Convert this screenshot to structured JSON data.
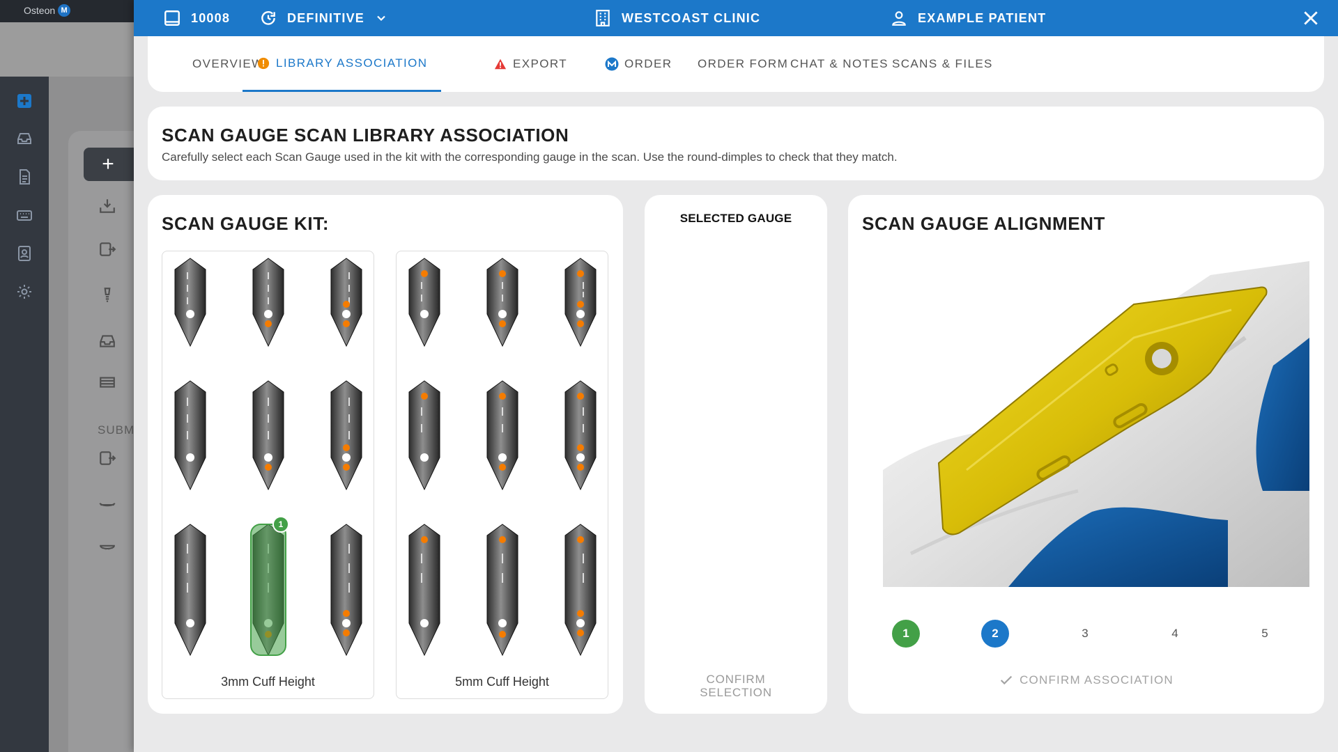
{
  "background": {
    "logo_text": "Osteon",
    "logo_mark": "M",
    "new_button": "+",
    "submenu_label": "SUBM"
  },
  "header": {
    "case_number": "10008",
    "stage": "DEFINITIVE",
    "clinic": "WESTCOAST CLINIC",
    "patient": "EXAMPLE PATIENT"
  },
  "tabs": [
    {
      "label": "OVERVIEW"
    },
    {
      "label": "LIBRARY ASSOCIATION"
    },
    {
      "label": "EXPORT"
    },
    {
      "label": "ORDER"
    },
    {
      "label": "ORDER FORM"
    },
    {
      "label": "CHAT & NOTES"
    },
    {
      "label": "SCANS & FILES"
    }
  ],
  "main": {
    "title": "SCAN GAUGE SCAN LIBRARY ASSOCIATION",
    "description": "Carefully select each Scan Gauge used in the kit with the corresponding gauge in the scan. Use the round-dimples to check that they match."
  },
  "kit": {
    "title": "SCAN GAUGE KIT:",
    "groups": [
      {
        "label": "3mm Cuff Height"
      },
      {
        "label": "5mm Cuff Height"
      }
    ],
    "selected_badge": "1"
  },
  "selected_gauge": {
    "title": "SELECTED GAUGE",
    "confirm_line1": "CONFIRM",
    "confirm_line2": "SELECTION"
  },
  "alignment": {
    "title": "SCAN GAUGE ALIGNMENT",
    "steps": [
      "1",
      "2",
      "3",
      "4",
      "5"
    ],
    "confirm_label": "CONFIRM ASSOCIATION"
  },
  "colors": {
    "accent": "#1c78c9",
    "success": "#43a047",
    "gauge_gold": "#d8bd08",
    "implant_blue": "#0f5aa0"
  }
}
